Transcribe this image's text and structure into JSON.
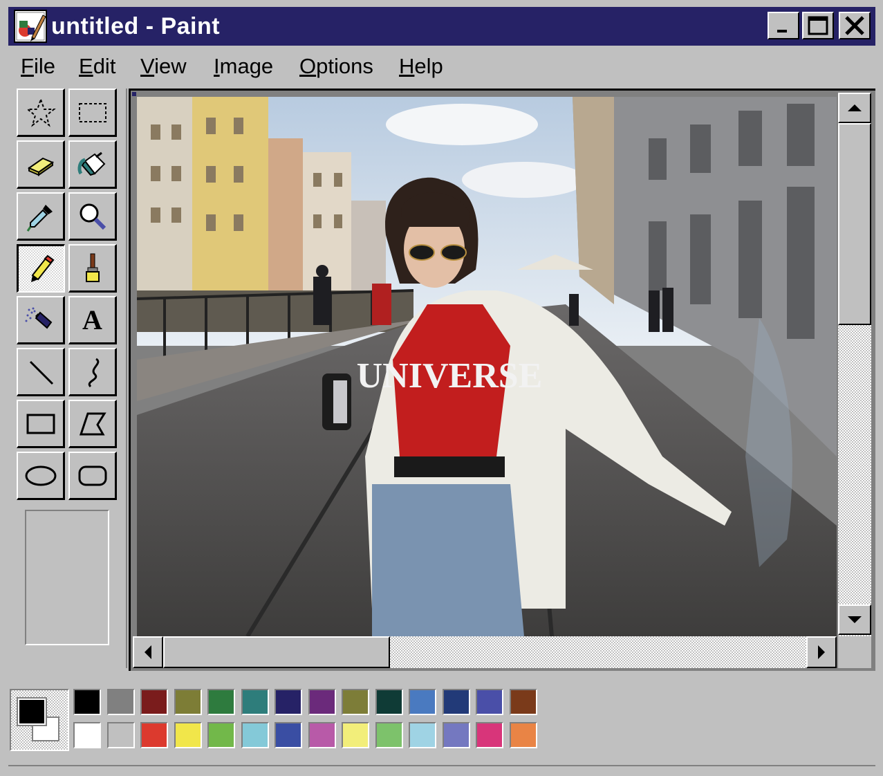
{
  "window": {
    "title": "untitled - Paint",
    "title_bar_color": "#262266",
    "controls": [
      "minimize-icon",
      "maximize-icon",
      "close-icon"
    ]
  },
  "menu": [
    {
      "label": "File",
      "accel": "F",
      "rest": "ile"
    },
    {
      "label": "Edit",
      "accel": "E",
      "rest": "dit"
    },
    {
      "label": "View",
      "accel": "V",
      "rest": "iew"
    },
    {
      "label": "Image",
      "accel": "I",
      "rest": "mage"
    },
    {
      "label": "Options",
      "accel": "O",
      "rest": "ptions"
    },
    {
      "label": "Help",
      "accel": "H",
      "rest": "elp"
    }
  ],
  "tools": [
    {
      "name": "free-form-select",
      "icon": "star-select-icon"
    },
    {
      "name": "select",
      "icon": "rectangle-select-icon"
    },
    {
      "name": "eraser",
      "icon": "eraser-icon"
    },
    {
      "name": "fill-with-color",
      "icon": "paint-bucket-icon"
    },
    {
      "name": "pick-color",
      "icon": "eyedropper-icon"
    },
    {
      "name": "magnifier",
      "icon": "magnifier-icon"
    },
    {
      "name": "pencil",
      "icon": "pencil-icon",
      "selected": true
    },
    {
      "name": "brush",
      "icon": "brush-icon"
    },
    {
      "name": "airbrush",
      "icon": "airbrush-icon"
    },
    {
      "name": "text",
      "icon": "text-icon",
      "glyph": "A"
    },
    {
      "name": "line",
      "icon": "line-icon"
    },
    {
      "name": "curve",
      "icon": "curve-icon"
    },
    {
      "name": "rectangle",
      "icon": "rectangle-icon"
    },
    {
      "name": "polygon",
      "icon": "polygon-icon"
    },
    {
      "name": "ellipse",
      "icon": "ellipse-icon"
    },
    {
      "name": "rounded-rectangle",
      "icon": "rounded-rectangle-icon"
    }
  ],
  "canvas": {
    "content": "photo-street-scene",
    "printed_text": "UNIVERSE"
  },
  "colors": {
    "foreground": "#000000",
    "background": "#ffffff",
    "palette_top": [
      "#000000",
      "#808080",
      "#7a1c1c",
      "#7d7d36",
      "#2e7b3e",
      "#2e7d7b",
      "#262266",
      "#6b2a7b",
      "#7d7d38",
      "#0f3b36",
      "#4a7ac0",
      "#223a78",
      "#4a4fa8",
      "#7a3a1a"
    ],
    "palette_bottom": [
      "#ffffff",
      "#c0c0c0",
      "#dc3a2e",
      "#f1e64a",
      "#72b84a",
      "#84c9d8",
      "#3a4ea3",
      "#b85aa8",
      "#f2ee7a",
      "#7dc26b",
      "#9fd3e4",
      "#7478c0",
      "#d8357a",
      "#e98445"
    ]
  }
}
